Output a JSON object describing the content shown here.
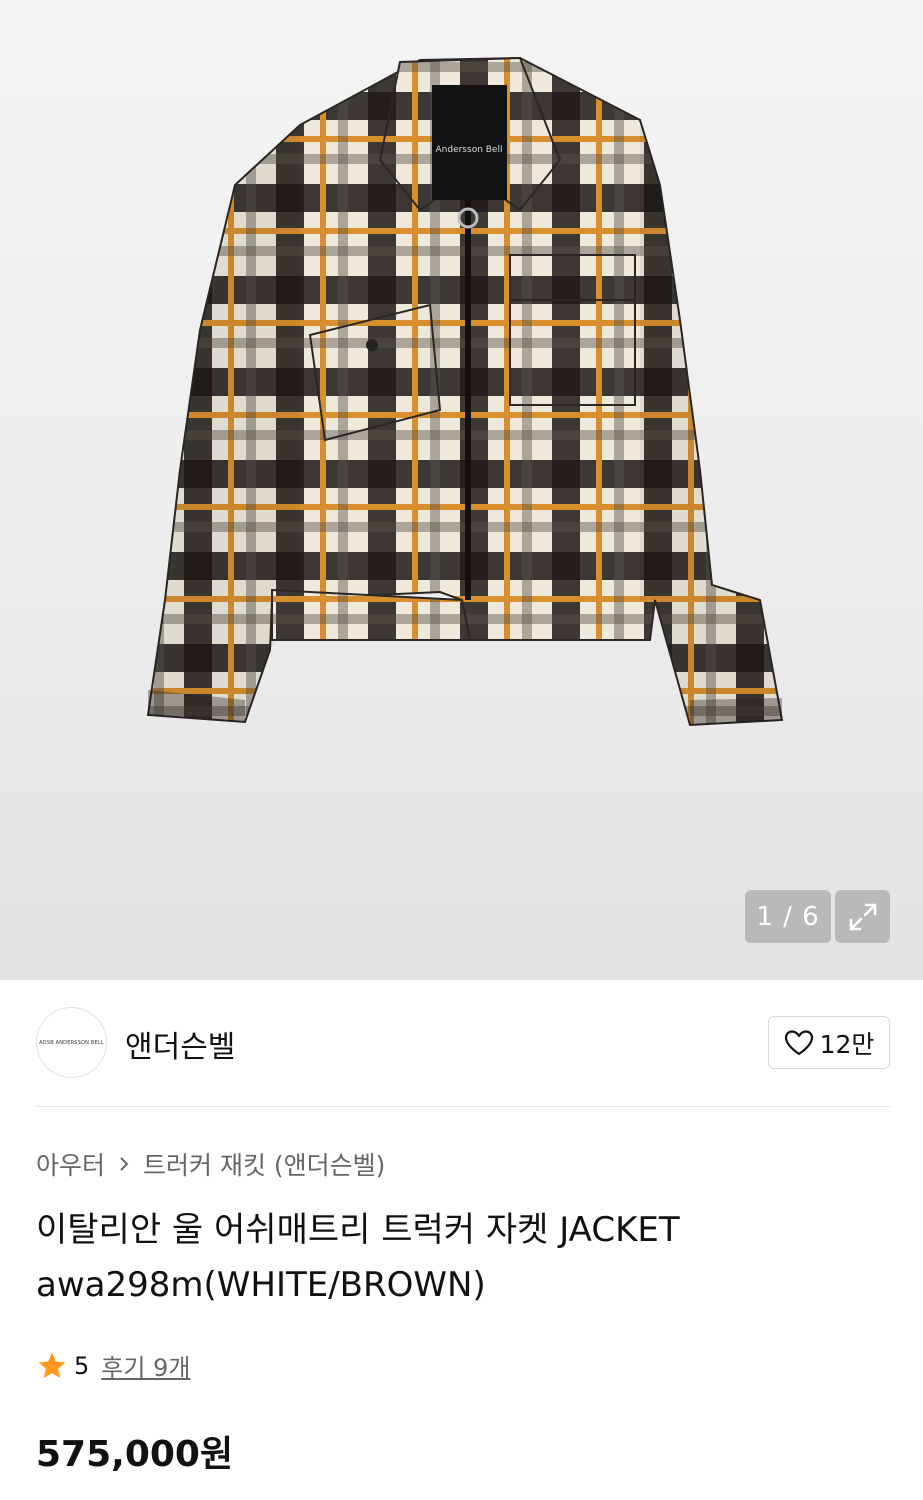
{
  "gallery": {
    "counter": "1 / 6",
    "jacket_label": "Andersson Bell",
    "colors": {
      "black": "#1c1a18",
      "orange": "#d8902e",
      "cream": "#efe9dc"
    }
  },
  "brand": {
    "logo_text": "ADSB ANDERSSON BELL",
    "name": "앤더슨벨",
    "likes": "12만"
  },
  "breadcrumb": {
    "category": "아우터",
    "subcategory": "트러커 재킷 (앤더슨벨)"
  },
  "product": {
    "title": "이탈리안 울 어쉬매트리 트럭커 자켓 JACKET awa298m(WHITE/BROWN)",
    "rating": "5",
    "reviews": "후기 9개",
    "price": "575,000원"
  },
  "colors": {
    "star": "#ff9a1f",
    "text": "#111111",
    "muted": "#666666"
  }
}
